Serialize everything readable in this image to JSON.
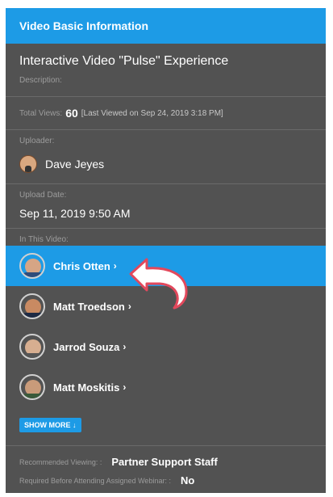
{
  "header": {
    "title": "Video Basic Information"
  },
  "video": {
    "title": "Interactive Video \"Pulse\" Experience",
    "description_label": "Description:",
    "views_label": "Total Views:",
    "views_count": "60",
    "last_viewed": "[Last Viewed on Sep 24, 2019 3:18 PM]",
    "uploader_label": "Uploader:",
    "uploader_name": "Dave Jeyes",
    "upload_date_label": "Upload Date:",
    "upload_date": "Sep 11, 2019 9:50 AM",
    "in_video_label": "In This Video:"
  },
  "people": [
    {
      "name": "Chris Otten",
      "chevron": "›",
      "selected": true
    },
    {
      "name": "Matt Troedson",
      "chevron": "›",
      "selected": false
    },
    {
      "name": "Jarrod Souza",
      "chevron": "›",
      "selected": false
    },
    {
      "name": "Matt Moskitis",
      "chevron": "›",
      "selected": false
    }
  ],
  "show_more": {
    "label": "SHOW MORE",
    "icon": "↓"
  },
  "recommended": {
    "label": "Recommended Viewing: :",
    "value": "Partner Support Staff"
  },
  "required": {
    "label": "Required Before Attending Assigned Webinar: :",
    "value": "No"
  },
  "colors": {
    "accent": "#1d9be6",
    "panel": "#525252",
    "arrow": "#e2485c"
  }
}
